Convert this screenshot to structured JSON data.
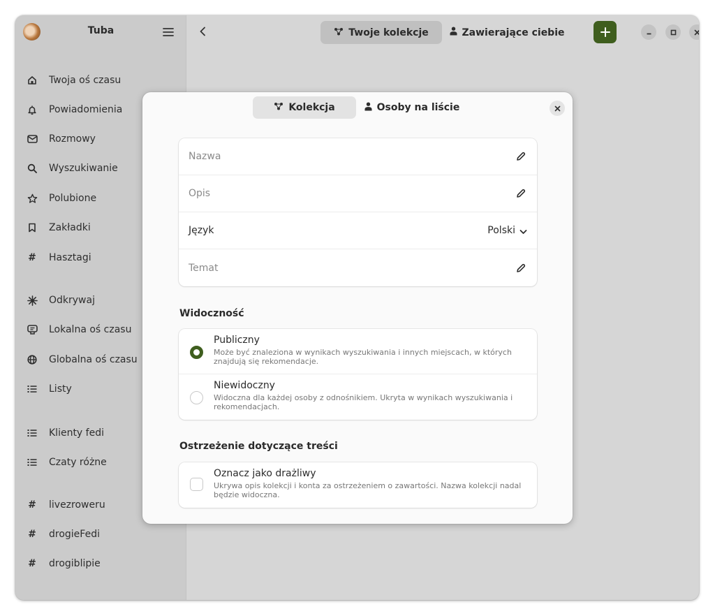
{
  "app": {
    "title": "Tuba"
  },
  "sidebar": {
    "items": [
      {
        "label": "Twoja oś czasu",
        "icon": "home-icon"
      },
      {
        "label": "Powiadomienia",
        "icon": "bell-icon"
      },
      {
        "label": "Rozmowy",
        "icon": "mail-icon"
      },
      {
        "label": "Wyszukiwanie",
        "icon": "search-icon"
      },
      {
        "label": "Polubione",
        "icon": "star-icon"
      },
      {
        "label": "Zakładki",
        "icon": "bookmark-icon"
      },
      {
        "label": "Hasztagi",
        "icon": "hashtag-icon"
      },
      {
        "label": "Odkrywaj",
        "icon": "explore-icon"
      },
      {
        "label": "Lokalna oś czasu",
        "icon": "local-icon"
      },
      {
        "label": "Globalna oś czasu",
        "icon": "globe-icon"
      },
      {
        "label": "Listy",
        "icon": "list-icon"
      },
      {
        "label": "Klienty fedi",
        "icon": "list-icon"
      },
      {
        "label": "Czaty różne",
        "icon": "list-icon"
      },
      {
        "label": "livezroweru",
        "icon": "hashtag-icon"
      },
      {
        "label": "drogieFedi",
        "icon": "hashtag-icon"
      },
      {
        "label": "drogiblipie",
        "icon": "hashtag-icon"
      }
    ]
  },
  "header": {
    "tabs": [
      {
        "label": "Twoje kolekcje",
        "icon": "collection-icon",
        "active": true
      },
      {
        "label": "Zawierające ciebie",
        "icon": "person-icon",
        "active": false
      }
    ]
  },
  "dialog": {
    "tabs": [
      {
        "label": "Kolekcja",
        "icon": "collection-icon",
        "active": true
      },
      {
        "label": "Osoby na liście",
        "icon": "person-icon",
        "active": false
      }
    ],
    "fields": {
      "name_placeholder": "Nazwa",
      "description_placeholder": "Opis",
      "language_label": "Język",
      "language_value": "Polski",
      "topic_placeholder": "Temat"
    },
    "visibility": {
      "title": "Widoczność",
      "options": [
        {
          "title": "Publiczny",
          "description": "Może być znaleziona w wynikach wyszukiwania i innych miejscach, w których znajdują się rekomendacje.",
          "selected": true
        },
        {
          "title": "Niewidoczny",
          "description": "Widoczna dla każdej osoby z odnośnikiem. Ukryta w wynikach wyszukiwania i rekomendacjach.",
          "selected": false
        }
      ]
    },
    "content_warning": {
      "title": "Ostrzeżenie dotyczące treści",
      "option_title": "Oznacz jako drażliwy",
      "option_description": "Ukrywa opis kolekcji i  konta za ostrzeżeniem o zawartości. Nazwa kolekcji nadal będzie widoczna.",
      "checked": false
    }
  },
  "colors": {
    "accent": "#3f5e1e"
  }
}
